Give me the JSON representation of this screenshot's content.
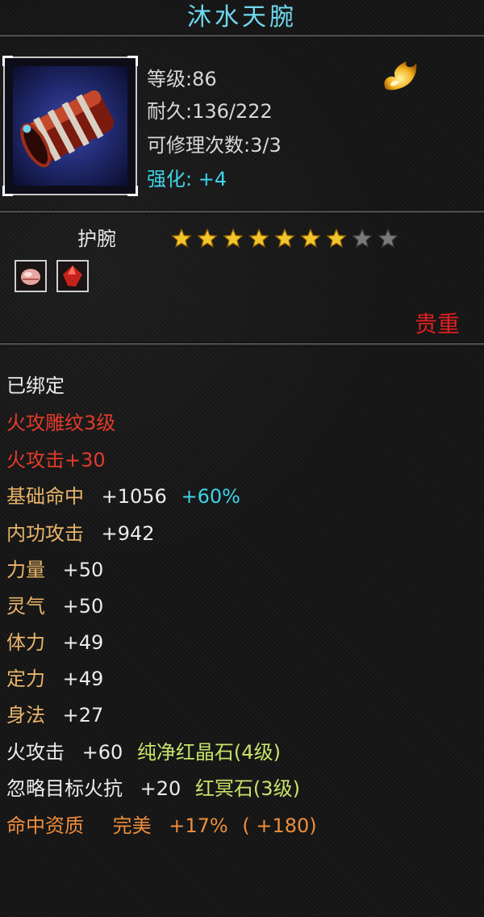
{
  "title": "沐水天腕",
  "item": {
    "icon": "bracer-item-icon",
    "level_line": "等级:86",
    "durability_line": "耐久:136/222",
    "repair_line": "可修理次数:3/3",
    "enhance_label": "强化:",
    "enhance_value": "+4",
    "flame_icon": "flame-icon"
  },
  "type_label": "护腕",
  "stars": {
    "filled": 7,
    "total": 9
  },
  "gems": [
    "pink-gem-icon",
    "red-gem-icon"
  ],
  "rarity": "贵重",
  "colors": {
    "title": "#6fd8ee",
    "cyan": "#3fd3e8",
    "red": "#e23a2a",
    "gold": "#e9b46a",
    "green": "#c9e36a",
    "orange": "#ee8d3c"
  },
  "stats": {
    "bound": "已绑定",
    "engrave": "火攻雕纹3级",
    "fire_attack": "火攻击+30",
    "hit_label": "基础命中",
    "hit_value": "+1056",
    "hit_pct": "+60%",
    "inner_label": "内功攻击",
    "inner_value": "+942",
    "str_label": "力量",
    "str_value": "+50",
    "spirit_label": "灵气",
    "spirit_value": "+50",
    "con_label": "体力",
    "con_value": "+49",
    "focus_label": "定力",
    "focus_value": "+49",
    "agi_label": "身法",
    "agi_value": "+27",
    "gem1_label": "火攻击",
    "gem1_value": "+60",
    "gem1_name": "纯净红晶石(4级)",
    "gem2_label": "忽略目标火抗",
    "gem2_value": "+20",
    "gem2_name": "红冥石(3级)",
    "qual_label": "命中资质",
    "qual_grade": "完美",
    "qual_pct": "+17%",
    "qual_bonus": "( +180)"
  }
}
